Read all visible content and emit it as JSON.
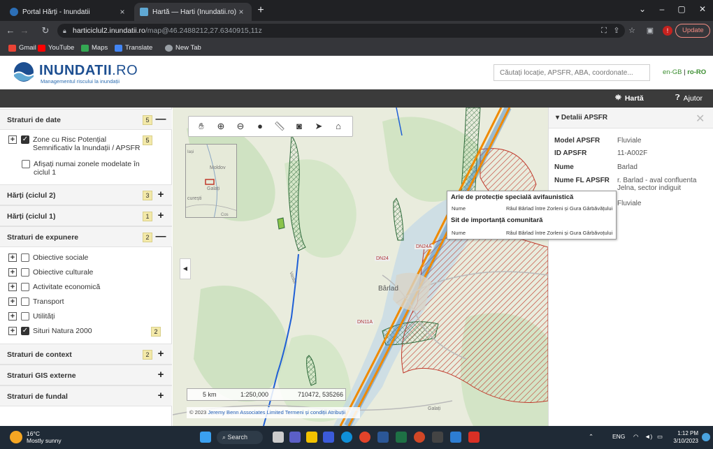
{
  "browser": {
    "tabs": [
      {
        "title": "Portal Hărți - Inundatii",
        "active": false
      },
      {
        "title": "Hartă — Harti (Inundatii.ro)",
        "active": true
      }
    ],
    "url_host": "harticiclul2.inundatii.ro",
    "url_path": "/map@46.2488212,27.6340915,11z",
    "update_label": "Update",
    "profile_initial": "!",
    "bookmarks": [
      "Gmail",
      "YouTube",
      "Maps",
      "Translate",
      "New Tab"
    ]
  },
  "site": {
    "logo_name": "INUNDATII",
    "logo_tld": ".RO",
    "logo_tagline": "Managementul riscului la inundații",
    "search_placeholder": "Căutați locație, APSFR, ABA, coordonate...",
    "lang_en": "en-GB",
    "lang_sep": " | ",
    "lang_ro": "ro-RO",
    "nav": {
      "map": "Hartă",
      "help": "Ajutor"
    }
  },
  "sidebar": {
    "sections": [
      {
        "title": "Straturi de date",
        "count": "5",
        "toggle": "—"
      },
      {
        "title": "Hărți (ciclul 2)",
        "count": "3",
        "toggle": "+"
      },
      {
        "title": "Hărți (ciclul 1)",
        "count": "1",
        "toggle": "+"
      },
      {
        "title": "Straturi de expunere",
        "count": "2",
        "toggle": "—"
      },
      {
        "title": "Straturi de context",
        "count": "2",
        "toggle": "+"
      },
      {
        "title": "Straturi GIS externe",
        "toggle": "+"
      },
      {
        "title": "Straturi de fundal",
        "toggle": "+"
      }
    ],
    "data_layers": {
      "apsfr_label_1": "Zone cu Risc Potențial",
      "apsfr_label_2": "Semnificativ la Inundații / APSFR",
      "apsfr_count": "5",
      "apsfr_checked": true,
      "modelled_label_1": "Afișați numai zonele modelate în",
      "modelled_label_2": "ciclul 1",
      "modelled_checked": false
    },
    "exposure_layers": [
      {
        "label": "Obiective sociale",
        "checked": false
      },
      {
        "label": "Obiective culturale",
        "checked": false
      },
      {
        "label": "Activitate economică",
        "checked": false
      },
      {
        "label": "Transport",
        "checked": false
      },
      {
        "label": "Utilități",
        "checked": false
      },
      {
        "label": "Situri Natura 2000",
        "checked": true,
        "count": "2"
      }
    ]
  },
  "map": {
    "tools": [
      "pan-hand",
      "zoom-in",
      "zoom-out",
      "info",
      "measure",
      "screenshot",
      "locate",
      "home"
    ],
    "overview_labels": {
      "moldova": "Moldov",
      "galati": "Galați",
      "bucuresti": "curești",
      "iasi": "Iași",
      "cos": "Cos"
    },
    "places": {
      "barlad": "Bârlad",
      "dn24": "DN24",
      "dn24a": "DN24A",
      "dn11a": "DN11A",
      "galati": "Galați",
      "vaslui_river": "Vaslui"
    },
    "scale": {
      "distance": "5 km",
      "ratio": "1:250,000",
      "coords": "710472, 535266"
    },
    "attribution": {
      "text": "© 2023 ",
      "owner": "Jeremy Benn Associates Limited",
      "terms": "Termeni și condiții",
      "attrib": "Atribuții"
    },
    "popup": {
      "sections": [
        {
          "heading": "Arie de protecție specială avifaunistică",
          "key": "Nume",
          "value": "Râul Bârlad între Zorleni și Gura Gârbăvățului"
        },
        {
          "heading": "Sit de importanță comunitară",
          "key": "Nume",
          "value": "Râul Bârlad între Zorleni și Gura Gârbăvoțului"
        }
      ]
    }
  },
  "details": {
    "title": "Detalii APSFR",
    "rows": [
      {
        "key": "Model APSFR",
        "value": "Fluviale"
      },
      {
        "key": "ID APSFR",
        "value": "11-A002F"
      },
      {
        "key": "Nume",
        "value": "Barlad"
      },
      {
        "key": "Nume FL APSFR",
        "value": "r. Barlad - aval confluenta Jelna, sector indiguit"
      },
      {
        "key": "Tip",
        "value": "Fluviale"
      }
    ]
  },
  "taskbar": {
    "temp": "16°C",
    "weather": "Mostly sunny",
    "search": "Search",
    "lang": "ENG",
    "time": "1:12 PM",
    "date": "3/10/2023"
  },
  "colors": {
    "river_blue": "#1f5fd6",
    "apsfr_orange": "#f08a00",
    "natura_hatch": "#2f6b3b",
    "risk_hatch_red": "#c0392b",
    "brand_blue": "#1d4f91"
  }
}
